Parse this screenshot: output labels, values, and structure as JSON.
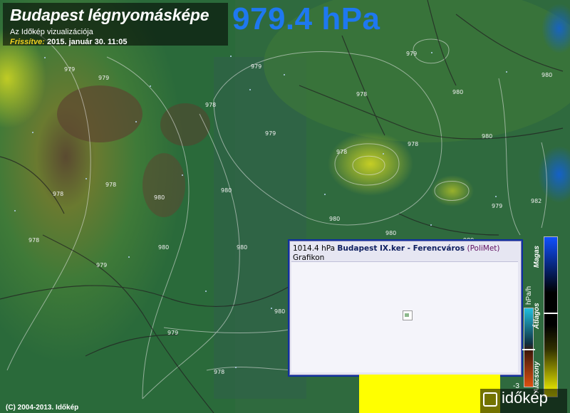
{
  "header": {
    "title": "Budapest légnyomásképe",
    "subtitle": "Az Időkép vizualizációja",
    "updated_label": "Frissítve:",
    "updated_value": "2015. január 30. 11:05"
  },
  "current_pressure": "979.4 hPa",
  "contour_labels": [
    "979",
    "979",
    "978",
    "979",
    "979",
    "978",
    "980",
    "980",
    "979",
    "980",
    "980",
    "978",
    "980",
    "980",
    "979",
    "978",
    "978",
    "979",
    "980",
    "978",
    "978",
    "980",
    "980",
    "980",
    "979",
    "978",
    "980",
    "982"
  ],
  "popup": {
    "pressure": "1014.4 hPa",
    "location": "Budapest IX.ker - Ferencváros",
    "source": "(PoliMet)",
    "link": "Grafikon"
  },
  "legend": {
    "high": "Magas",
    "average": "Átlagos",
    "low": "Alacsony",
    "unit": "hPa/h",
    "minus3": "-3"
  },
  "footer": {
    "copyright": "(C) 2004-2013. Időkép",
    "brand": "időkép"
  },
  "colors": {
    "pressure_text": "#1e78f0",
    "popup_border": "#1030a0",
    "updated_label": "#f0d020"
  }
}
